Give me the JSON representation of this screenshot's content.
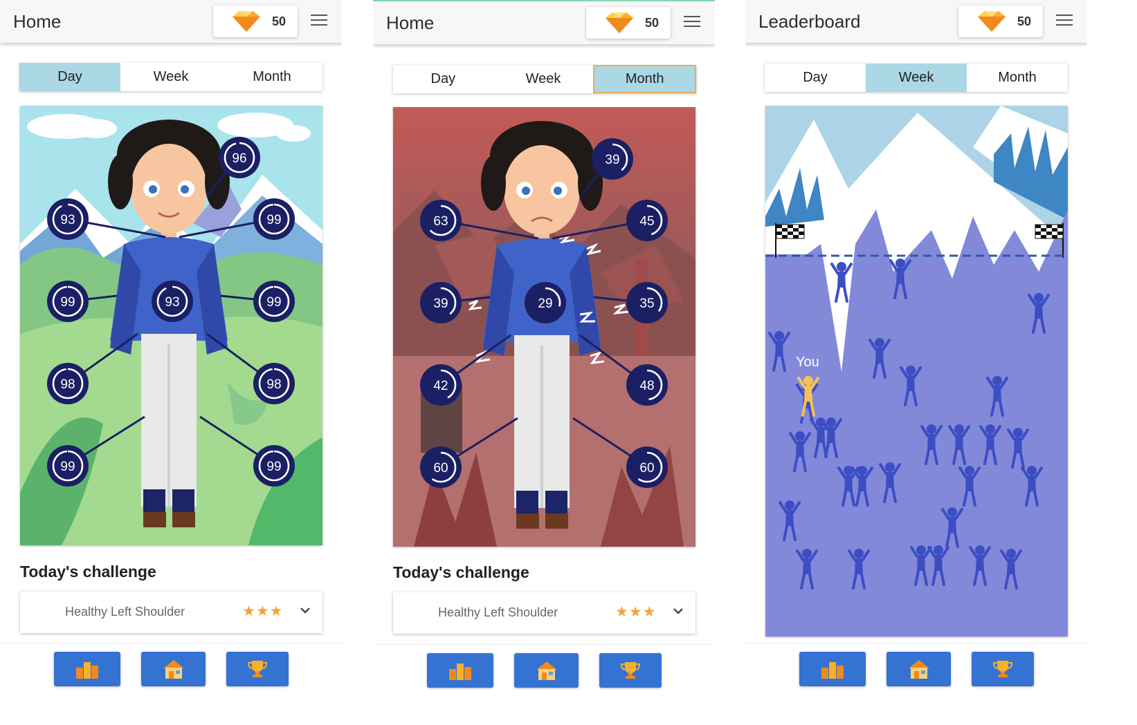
{
  "screens": [
    {
      "title": "Home",
      "gem_count": "50",
      "tabs": [
        "Day",
        "Week",
        "Month"
      ],
      "active_tab": "Day",
      "body_scores": {
        "head": "96",
        "left_shoulder": "93",
        "right_shoulder": "99",
        "left_elbow": "99",
        "core": "93",
        "right_elbow": "99",
        "left_hip": "98",
        "right_hip": "98",
        "left_knee": "99",
        "right_knee": "99"
      },
      "challenge_heading": "Today's challenge",
      "challenge_name": "Healthy Left Shoulder",
      "challenge_stars": "★★★",
      "mood": "happy"
    },
    {
      "title": "Home",
      "gem_count": "50",
      "tabs": [
        "Day",
        "Week",
        "Month"
      ],
      "active_tab": "Month",
      "body_scores": {
        "head": "39",
        "left_shoulder": "63",
        "right_shoulder": "45",
        "left_elbow": "39",
        "core": "29",
        "right_elbow": "35",
        "left_hip": "42",
        "right_hip": "48",
        "left_knee": "60",
        "right_knee": "60"
      },
      "challenge_heading": "Today's challenge",
      "challenge_name": "Healthy Left Shoulder",
      "challenge_stars": "★★★",
      "mood": "sad"
    },
    {
      "title": "Leaderboard",
      "gem_count": "50",
      "tabs": [
        "Day",
        "Week",
        "Month"
      ],
      "active_tab": "Week",
      "player_label": "You"
    }
  ],
  "bottom_nav": [
    "leaderboard-podium-icon",
    "home-icon",
    "trophy-icon"
  ],
  "colors": {
    "accent_blue": "#3473d2",
    "tab_active": "#acd7e4",
    "score_circle": "#1b1f63",
    "star": "#f4a23a",
    "climber": "#3c4ec4",
    "player": "#f5c25a"
  }
}
